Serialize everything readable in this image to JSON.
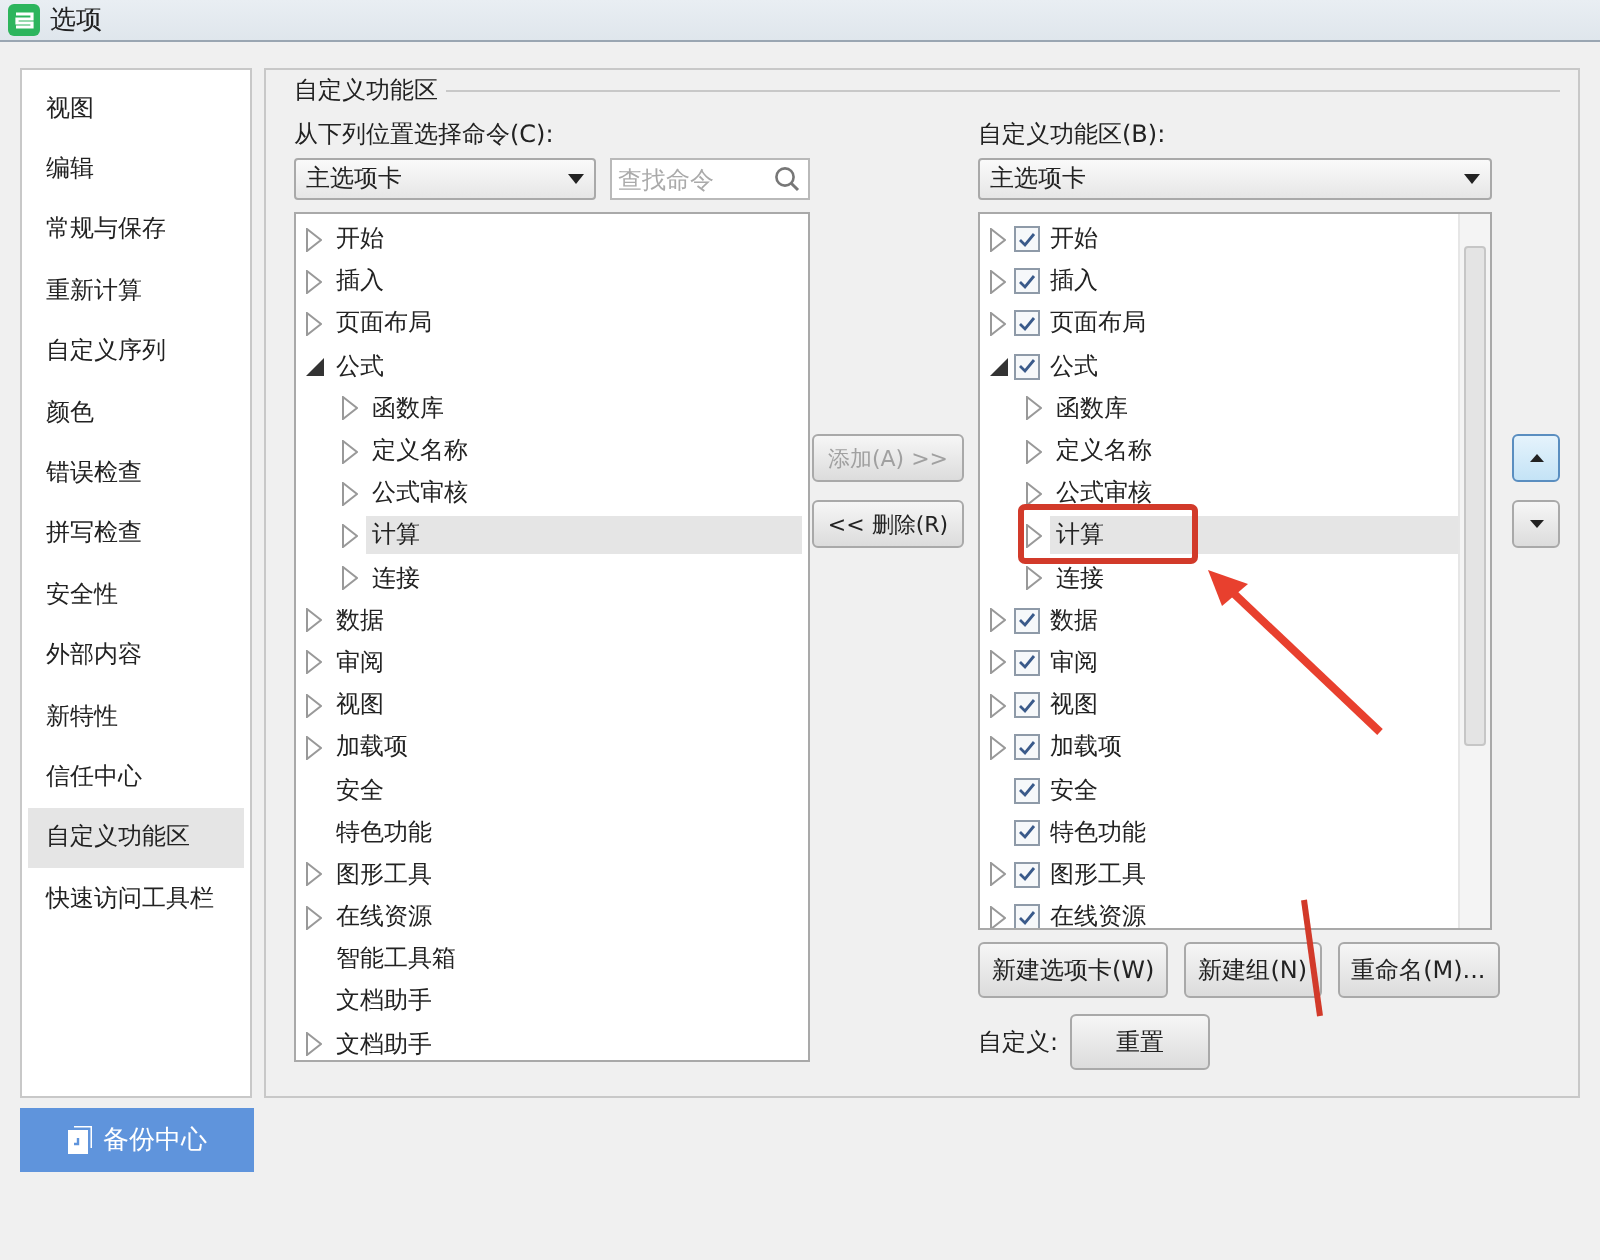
{
  "window": {
    "title": "选项"
  },
  "sidebar": {
    "items": [
      {
        "label": "视图",
        "selected": false
      },
      {
        "label": "编辑",
        "selected": false
      },
      {
        "label": "常规与保存",
        "selected": false
      },
      {
        "label": "重新计算",
        "selected": false
      },
      {
        "label": "自定义序列",
        "selected": false
      },
      {
        "label": "颜色",
        "selected": false
      },
      {
        "label": "错误检查",
        "selected": false
      },
      {
        "label": "拼写检查",
        "selected": false
      },
      {
        "label": "安全性",
        "selected": false
      },
      {
        "label": "外部内容",
        "selected": false
      },
      {
        "label": "新特性",
        "selected": false
      },
      {
        "label": "信任中心",
        "selected": false
      },
      {
        "label": "自定义功能区",
        "selected": true
      },
      {
        "label": "快速访问工具栏",
        "selected": false
      }
    ]
  },
  "group_title": "自定义功能区",
  "left": {
    "label": "从下列位置选择命令(C):",
    "dropdown": "主选项卡",
    "search": {
      "placeholder": "查找命令"
    },
    "tree": [
      {
        "label": "开始",
        "kind": "node",
        "expanded": false,
        "selected": false
      },
      {
        "label": "插入",
        "kind": "node",
        "expanded": false,
        "selected": false
      },
      {
        "label": "页面布局",
        "kind": "node",
        "expanded": false,
        "selected": false
      },
      {
        "label": "公式",
        "kind": "node",
        "expanded": true,
        "selected": false,
        "children": [
          {
            "label": "函数库",
            "kind": "node",
            "expanded": false,
            "selected": false
          },
          {
            "label": "定义名称",
            "kind": "node",
            "expanded": false,
            "selected": false
          },
          {
            "label": "公式审核",
            "kind": "node",
            "expanded": false,
            "selected": false
          },
          {
            "label": "计算",
            "kind": "node",
            "expanded": false,
            "selected": true
          },
          {
            "label": "连接",
            "kind": "node",
            "expanded": false,
            "selected": false
          }
        ]
      },
      {
        "label": "数据",
        "kind": "node",
        "expanded": false,
        "selected": false
      },
      {
        "label": "审阅",
        "kind": "node",
        "expanded": false,
        "selected": false
      },
      {
        "label": "视图",
        "kind": "node",
        "expanded": false,
        "selected": false
      },
      {
        "label": "加载项",
        "kind": "node",
        "expanded": false,
        "selected": false
      },
      {
        "label": "安全",
        "kind": "leaf",
        "selected": false
      },
      {
        "label": "特色功能",
        "kind": "leaf",
        "selected": false
      },
      {
        "label": "图形工具",
        "kind": "node",
        "expanded": false,
        "selected": false
      },
      {
        "label": "在线资源",
        "kind": "node",
        "expanded": false,
        "selected": false
      },
      {
        "label": "智能工具箱",
        "kind": "leaf",
        "selected": false
      },
      {
        "label": "文档助手",
        "kind": "leaf",
        "selected": false
      },
      {
        "label": "文档助手",
        "kind": "node",
        "expanded": false,
        "selected": false
      }
    ]
  },
  "transfer_buttons": [
    {
      "label": "添加(A) >>",
      "disabled": true
    },
    {
      "label": "<< 删除(R)",
      "disabled": false
    }
  ],
  "right": {
    "label": "自定义功能区(B):",
    "dropdown": "主选项卡",
    "tree": [
      {
        "label": "开始",
        "kind": "node",
        "expanded": false,
        "checked": true,
        "selected": false
      },
      {
        "label": "插入",
        "kind": "node",
        "expanded": false,
        "checked": true,
        "selected": false
      },
      {
        "label": "页面布局",
        "kind": "node",
        "expanded": false,
        "checked": true,
        "selected": false
      },
      {
        "label": "公式",
        "kind": "node",
        "expanded": true,
        "checked": true,
        "selected": false,
        "children": [
          {
            "label": "函数库",
            "kind": "node",
            "expanded": false,
            "selected": false
          },
          {
            "label": "定义名称",
            "kind": "node",
            "expanded": false,
            "selected": false
          },
          {
            "label": "公式审核",
            "kind": "node",
            "expanded": false,
            "selected": false
          },
          {
            "label": "计算",
            "kind": "node",
            "expanded": false,
            "selected": true
          },
          {
            "label": "连接",
            "kind": "node",
            "expanded": false,
            "selected": false
          }
        ]
      },
      {
        "label": "数据",
        "kind": "node",
        "expanded": false,
        "checked": true,
        "selected": false
      },
      {
        "label": "审阅",
        "kind": "node",
        "expanded": false,
        "checked": true,
        "selected": false
      },
      {
        "label": "视图",
        "kind": "node",
        "expanded": false,
        "checked": true,
        "selected": false
      },
      {
        "label": "加载项",
        "kind": "node",
        "expanded": false,
        "checked": true,
        "selected": false
      },
      {
        "label": "安全",
        "kind": "leaf",
        "checked": true,
        "selected": false
      },
      {
        "label": "特色功能",
        "kind": "leaf",
        "checked": true,
        "selected": false
      },
      {
        "label": "图形工具",
        "kind": "node",
        "expanded": false,
        "checked": true,
        "selected": false
      },
      {
        "label": "在线资源",
        "kind": "node",
        "expanded": false,
        "checked": true,
        "selected": false
      }
    ],
    "buttons": [
      "新建选项卡(W)",
      "新建组(N)",
      "重命名(M)..."
    ],
    "customize_label": "自定义:",
    "reset_button": "重置"
  },
  "backup_button": "备份中心"
}
